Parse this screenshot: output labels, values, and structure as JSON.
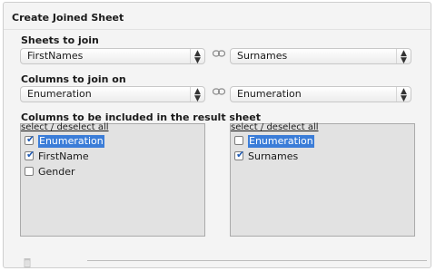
{
  "dialog": {
    "title": "Create Joined Sheet"
  },
  "sheets": {
    "label": "Sheets to join",
    "left_value": "FirstNames",
    "right_value": "Surnames"
  },
  "columns": {
    "label": "Columns to join on",
    "left_value": "Enumeration",
    "right_value": "Enumeration"
  },
  "result": {
    "label": "Columns to be included in the result sheet",
    "left": {
      "select_all": "select / deselect all",
      "items": [
        {
          "label": "Enumeration",
          "checked": true,
          "selected": true
        },
        {
          "label": "FirstName",
          "checked": true,
          "selected": false
        },
        {
          "label": "Gender",
          "checked": false,
          "selected": false
        }
      ]
    },
    "right": {
      "select_all": "select / deselect all",
      "items": [
        {
          "label": "Enumeration",
          "checked": false,
          "selected": true
        },
        {
          "label": "Surnames",
          "checked": true,
          "selected": false
        }
      ]
    }
  },
  "icons": {
    "link": "link-icon",
    "delete": "trash-icon",
    "select_arrows": "up-down-arrows-icon"
  },
  "colors": {
    "selection": "#3b7dd8",
    "checkmark": "#1f5bb5"
  }
}
